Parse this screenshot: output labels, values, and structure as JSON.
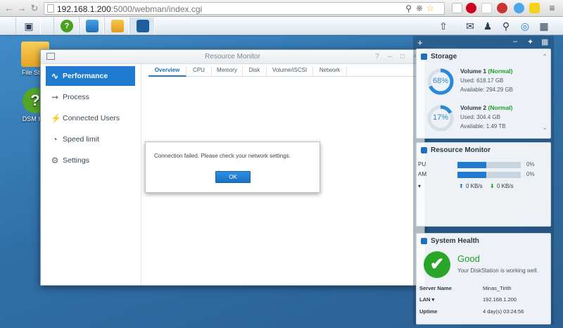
{
  "browser": {
    "url_host": "192.168.1.200",
    "url_rest": ":5000/webman/index.cgi"
  },
  "desktop": {
    "icons": [
      {
        "label": "File Sta..."
      },
      {
        "label": "DSM H..."
      }
    ]
  },
  "window": {
    "title": "Resource Monitor",
    "sidebar": [
      {
        "label": "Performance"
      },
      {
        "label": "Process"
      },
      {
        "label": "Connected Users"
      },
      {
        "label": "Speed limit"
      },
      {
        "label": "Settings"
      }
    ],
    "tabs": [
      "Overview",
      "CPU",
      "Memory",
      "Disk",
      "Volume/iSCSI",
      "Network"
    ]
  },
  "dialog": {
    "message": "Connection failed. Please check your network settings.",
    "ok": "OK"
  },
  "widgets": {
    "storage": {
      "title": "Storage",
      "volumes": [
        {
          "name": "Volume 1",
          "status": "(Normal)",
          "percent": "68%",
          "percent_value": 0.68,
          "used": "Used: 618.17 GB",
          "available": "Available: 294.29 GB"
        },
        {
          "name": "Volume 2",
          "status": "(Normal)",
          "percent": "17%",
          "percent_value": 0.17,
          "used": "Used: 304.4 GB",
          "available": "Available: 1.49 TB"
        }
      ]
    },
    "resource_monitor": {
      "title": "Resource Monitor",
      "cpu_label": "PU",
      "cpu_value": "0%",
      "cpu_fill": 0.45,
      "ram_label": "AM",
      "ram_value": "0%",
      "ram_fill": 0.45,
      "up": "0 KB/s",
      "down": "0 KB/s"
    },
    "system_health": {
      "title": "System Health",
      "status": "Good",
      "message": "Your DiskStation is working well.",
      "server_name_label": "Server Name",
      "server_name": "Minas_Tirith",
      "lan_label": "LAN",
      "lan_value": "192.168.1.200",
      "uptime_label": "Uptime",
      "uptime_value": "4 day(s) 03:24:56"
    }
  },
  "colors": {
    "accent": "#1e7bd0",
    "good": "#1e9a2a"
  }
}
